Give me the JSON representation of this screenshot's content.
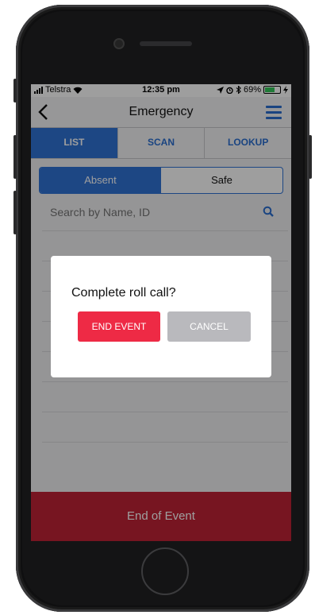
{
  "statusbar": {
    "carrier": "Telstra",
    "time": "12:35 pm",
    "battery": "69%",
    "battery_level": 0.69
  },
  "navbar": {
    "title": "Emergency"
  },
  "tabs": [
    {
      "label": "LIST",
      "active": true
    },
    {
      "label": "SCAN",
      "active": false
    },
    {
      "label": "LOOKUP",
      "active": false
    }
  ],
  "segment": {
    "options": [
      {
        "label": "Absent",
        "active": true
      },
      {
        "label": "Safe",
        "active": false
      }
    ]
  },
  "search": {
    "placeholder": "Search by Name, ID",
    "value": ""
  },
  "dialog": {
    "title": "Complete roll call?",
    "confirm_label": "END EVENT",
    "cancel_label": "CANCEL"
  },
  "footer": {
    "label": "End of Event"
  },
  "colors": {
    "primary_blue": "#2f73d6",
    "danger_red": "#ee2a45",
    "footer_red": "#c02336",
    "cancel_gray": "#b9b9bd"
  },
  "icons": {
    "back": "chevron-left-icon",
    "menu": "hamburger-menu-icon",
    "search": "search-icon",
    "wifi": "wifi-icon",
    "location": "location-arrow-icon",
    "alarm": "alarm-clock-icon",
    "bluetooth": "bluetooth-icon",
    "battery": "battery-icon",
    "charging": "charging-bolt-icon"
  }
}
